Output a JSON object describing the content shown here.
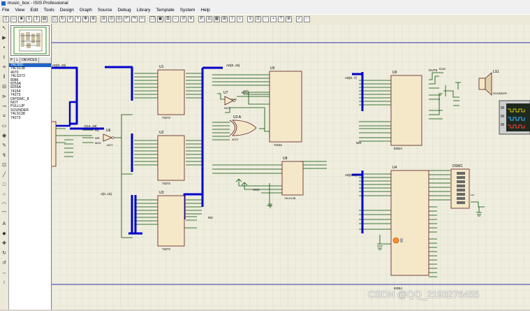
{
  "app": {
    "title": "music_box - ISIS Professional"
  },
  "menu": [
    "File",
    "View",
    "Edit",
    "Tools",
    "Design",
    "Graph",
    "Source",
    "Debug",
    "Library",
    "Template",
    "System",
    "Help"
  ],
  "toolbar_icons": [
    "new-file-icon",
    "open-icon",
    "save-icon",
    "import-icon",
    "export-icon",
    "print-icon",
    "area-icon",
    "refresh-icon",
    "grid-icon",
    "origin-icon",
    "pan-icon",
    "zoom-in-icon",
    "zoom-out-icon",
    "zoom-all-icon",
    "zoom-area-icon",
    "undo-icon",
    "redo-icon",
    "cut-icon",
    "copy-icon",
    "paste-icon",
    "block-copy-icon",
    "block-move-icon",
    "block-rotate-icon",
    "block-delete-icon",
    "pick-icon",
    "make-device-icon",
    "packaging-icon",
    "decompose-icon",
    "wire-autorouter-icon",
    "search-icon",
    "property-icon",
    "design-explorer-icon",
    "new-sheet-icon",
    "remove-sheet-icon",
    "exit-parent-icon",
    "bom-icon",
    "erc-icon",
    "netlist-icon"
  ],
  "side_tools": [
    "select-icon",
    "component-icon",
    "junction-icon",
    "label-icon",
    "text-icon",
    "bus-icon",
    "subcircuit-icon",
    "terminal-icon",
    "pin-icon",
    "graph-icon",
    "tape-icon",
    "generator-icon",
    "probe-v-icon",
    "probe-i-icon",
    "instrument-icon",
    "line-icon",
    "box-icon",
    "circle-icon",
    "arc-icon",
    "path-icon",
    "text-2d-icon",
    "symbol-icon",
    "marker-icon",
    "rotate-cw-icon",
    "rotate-ccw-icon",
    "mirror-x-icon",
    "mirror-y-icon"
  ],
  "panel": {
    "tabs": [
      "P",
      "L",
      "DEVICES"
    ],
    "devices": [
      "74LS00",
      "74LS138",
      "4070",
      "74LS373",
      "8086",
      "8253A",
      "8255A",
      "74154",
      "74273",
      "DIPSWC_8",
      "NOT",
      "PULLUP",
      "SOUNDER",
      "74LS138",
      "74273"
    ],
    "selected_index": 0
  },
  "schematic": {
    "chips": {
      "u1": {
        "label": "U1",
        "part": "74273"
      },
      "u2": {
        "label": "U2",
        "part": "74273"
      },
      "u3": {
        "label": "U3",
        "part": "74273"
      },
      "u5": {
        "label": "U5",
        "part": "74154"
      },
      "u6": {
        "label": "U6",
        "part": "NOT"
      },
      "u7": {
        "label": "U7",
        "part": "NOT"
      },
      "u2a": {
        "label": "U2:A",
        "part": "4070"
      },
      "u4": {
        "label": "U4",
        "part": "8255A"
      },
      "u8": {
        "label": "U8",
        "part": "74LS138"
      },
      "u9": {
        "label": "U9",
        "part": "8253A"
      },
      "ls1": {
        "label": "LS1",
        "part": "SOUNDER"
      },
      "dsw1": {
        "label": "DSW1"
      }
    },
    "nets": [
      "AD[0..15]",
      "AD[0..15]",
      "AD[0..7]",
      "AD[0..7]",
      "A[16..19]",
      "A[0..15]",
      "IO/M",
      "WR",
      "RD",
      "CLK",
      "OUT0",
      "VCC"
    ]
  },
  "watermark": "CSDN @QQ_2193276455",
  "colors": {
    "bus": "#0000cc",
    "wire": "#005000",
    "chip": "#f5e8c8",
    "grid": "#d6d3c2",
    "canvas": "#efedde",
    "sheet_border": "#3333aa"
  }
}
